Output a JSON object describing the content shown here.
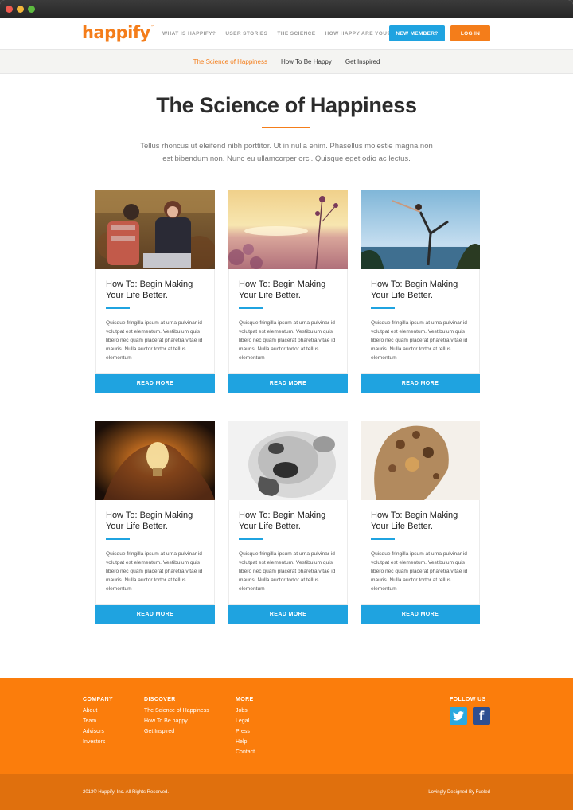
{
  "window": {
    "controls": [
      "close",
      "minimize",
      "maximize"
    ]
  },
  "header": {
    "logo": "happify",
    "logo_mark": "™",
    "nav": [
      "WHAT IS HAPPIFY?",
      "USER STORIES",
      "THE SCIENCE",
      "HOW HAPPY ARE YOU?"
    ],
    "new_member_label": "NEW MEMBER?",
    "login_label": "LOG IN"
  },
  "subnav": {
    "items": [
      {
        "label": "The Science of Happiness",
        "active": true
      },
      {
        "label": "How To Be Happy",
        "active": false
      },
      {
        "label": "Get Inspired",
        "active": false
      }
    ]
  },
  "hero": {
    "title": "The Science of Happiness",
    "desc_line1": "Tellus rhoncus ut eleifend nibh porttitor. Ut in nulla enim. Phasellus molestie magna non",
    "desc_line2": "est bibendum non. Nunc eu ullamcorper orci. Quisque eget odio ac lectus."
  },
  "cards": [
    {
      "image": "couple-autumn-photo",
      "title": "How To: Begin Making Your Life Better.",
      "text": "Quisque fringilla ipsum at urna pulvinar id volutpat est elementum. Vestibulum quis libero nec quam placerat pharetra vitae id mauris. Nulla auctor tortor at tellus elementum",
      "button": "READ MORE"
    },
    {
      "image": "flowers-sunset-photo",
      "title": "How To: Begin Making Your Life Better.",
      "text": "Quisque fringilla ipsum at urna pulvinar id volutpat est elementum. Vestibulum quis libero nec quam placerat pharetra vitae id mauris. Nulla auctor tortor at tellus elementum",
      "button": "READ MORE"
    },
    {
      "image": "yoga-beach-photo",
      "title": "How To: Begin Making Your Life Better.",
      "text": "Quisque fringilla ipsum at urna pulvinar id volutpat est elementum. Vestibulum quis libero nec quam placerat pharetra vitae id mauris. Nulla auctor tortor at tellus elementum",
      "button": "READ MORE"
    },
    {
      "image": "lightbulb-hands-photo",
      "title": "How To: Begin Making Your Life Better.",
      "text": "Quisque fringilla ipsum at urna pulvinar id volutpat est elementum. Vestibulum quis libero nec quam placerat pharetra vitae id mauris. Nulla auctor tortor at tellus elementum",
      "button": "READ MORE"
    },
    {
      "image": "bulldog-photo",
      "title": "How To: Begin Making Your Life Better.",
      "text": "Quisque fringilla ipsum at urna pulvinar id volutpat est elementum. Vestibulum quis libero nec quam placerat pharetra vitae id mauris. Nulla auctor tortor at tellus elementum",
      "button": "READ MORE"
    },
    {
      "image": "double-exposure-photo",
      "title": "How To: Begin Making Your Life Better.",
      "text": "Quisque fringilla ipsum at urna pulvinar id volutpat est elementum. Vestibulum quis libero nec quam placerat pharetra vitae id mauris. Nulla auctor tortor at tellus elementum",
      "button": "READ MORE"
    }
  ],
  "footer": {
    "columns": [
      {
        "heading": "COMPANY",
        "links": [
          "About",
          "Team",
          "Advisors",
          "Investors"
        ]
      },
      {
        "heading": "DISCOVER",
        "links": [
          "The Science of Happiness",
          "How To Be happy",
          "Get Inspired"
        ]
      },
      {
        "heading": "MORE",
        "links": [
          "Jobs",
          "Legal",
          "Press",
          "Help",
          "Contact"
        ]
      }
    ],
    "follow_heading": "FOLLOW US",
    "social": [
      {
        "icon": "twitter-icon",
        "color": "#2aa9e0"
      },
      {
        "icon": "facebook-icon",
        "color": "#2d4f91",
        "glyph": "f"
      }
    ],
    "copyright": "2013© Happify, Inc. All Rights Reserved.",
    "designed_by": "Lovingly Designed By Fueled"
  },
  "colors": {
    "accent": "#f47d1a",
    "blue": "#1fa3e0",
    "footer": "#fb7d0c"
  }
}
